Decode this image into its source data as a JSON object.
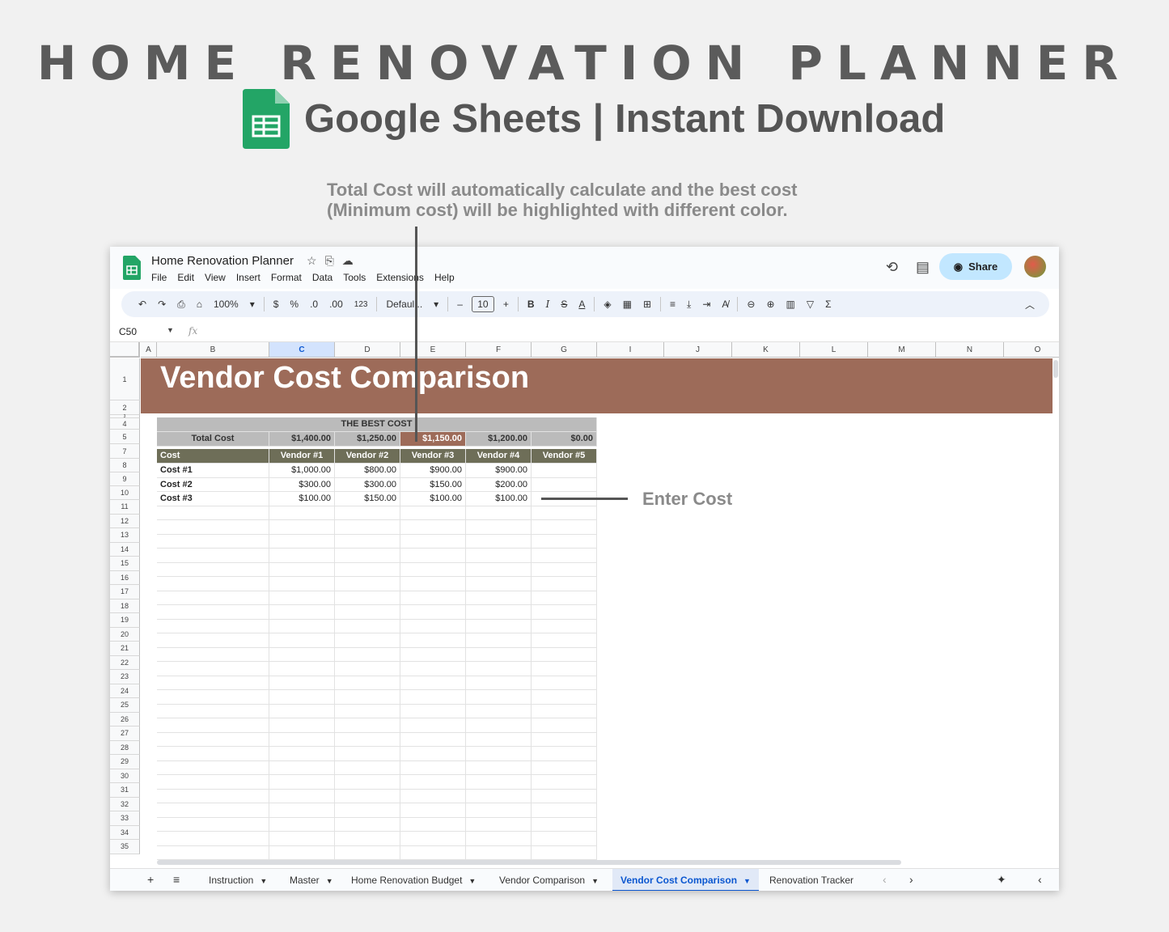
{
  "banner": {
    "title": "HOME RENOVATION PLANNER",
    "subtitle": "Google Sheets | Instant Download"
  },
  "annotations": {
    "callout": "Total Cost will automatically calculate and the best cost (Minimum cost) will be highlighted with different color.",
    "enter_cost": "Enter Cost"
  },
  "app": {
    "doc_title": "Home Renovation Planner",
    "menu": [
      "File",
      "Edit",
      "View",
      "Insert",
      "Format",
      "Data",
      "Tools",
      "Extensions",
      "Help"
    ],
    "share_label": "Share"
  },
  "toolbar": {
    "zoom": "100%",
    "currency": "$",
    "percent": "%",
    "dec_decrease": ".0",
    "dec_increase": ".00",
    "number_format": "123",
    "font": "Defaul...",
    "minus": "–",
    "font_size": "10",
    "plus": "+",
    "bold": "B",
    "italic": "I",
    "strike": "S",
    "text_color": "A",
    "sum": "Σ"
  },
  "formula_bar": {
    "name_box": "C50",
    "fx": "fx"
  },
  "columns": [
    "A",
    "B",
    "C",
    "D",
    "E",
    "F",
    "G",
    "I",
    "J",
    "K",
    "L",
    "M",
    "N",
    "O"
  ],
  "rows": [
    "1",
    "2",
    "3",
    "4",
    "5",
    "7",
    "8",
    "9",
    "10",
    "11",
    "12",
    "13",
    "14",
    "15",
    "16",
    "17",
    "18",
    "19",
    "20",
    "21",
    "22",
    "23",
    "24",
    "25",
    "26",
    "27",
    "28",
    "29",
    "30",
    "31",
    "32",
    "33",
    "34",
    "35"
  ],
  "sheet": {
    "title": "Vendor Cost Comparison",
    "best_cost_label": "THE BEST COST",
    "total_label": "Total Cost",
    "totals": [
      "$1,400.00",
      "$1,250.00",
      "$1,150.00",
      "$1,200.00",
      "$0.00"
    ],
    "best_index": 2,
    "header": [
      "Cost",
      "Vendor #1",
      "Vendor #2",
      "Vendor #3",
      "Vendor #4",
      "Vendor #5"
    ],
    "items": [
      {
        "label": "Cost #1",
        "values": [
          "$1,000.00",
          "$800.00",
          "$900.00",
          "$900.00",
          ""
        ]
      },
      {
        "label": "Cost #2",
        "values": [
          "$300.00",
          "$300.00",
          "$150.00",
          "$200.00",
          ""
        ]
      },
      {
        "label": "Cost #3",
        "values": [
          "$100.00",
          "$150.00",
          "$100.00",
          "$100.00",
          ""
        ]
      }
    ],
    "colors": {
      "title_band": "#9d6b59",
      "header": "#6e6e58",
      "best": "#9d6b59",
      "totals": "#bbbbbb"
    }
  },
  "tabs": [
    "Instruction",
    "Master",
    "Home Renovation Budget",
    "Vendor Comparison",
    "Vendor Cost Comparison",
    "Renovation Tracker"
  ],
  "active_tab": "Vendor Cost Comparison"
}
